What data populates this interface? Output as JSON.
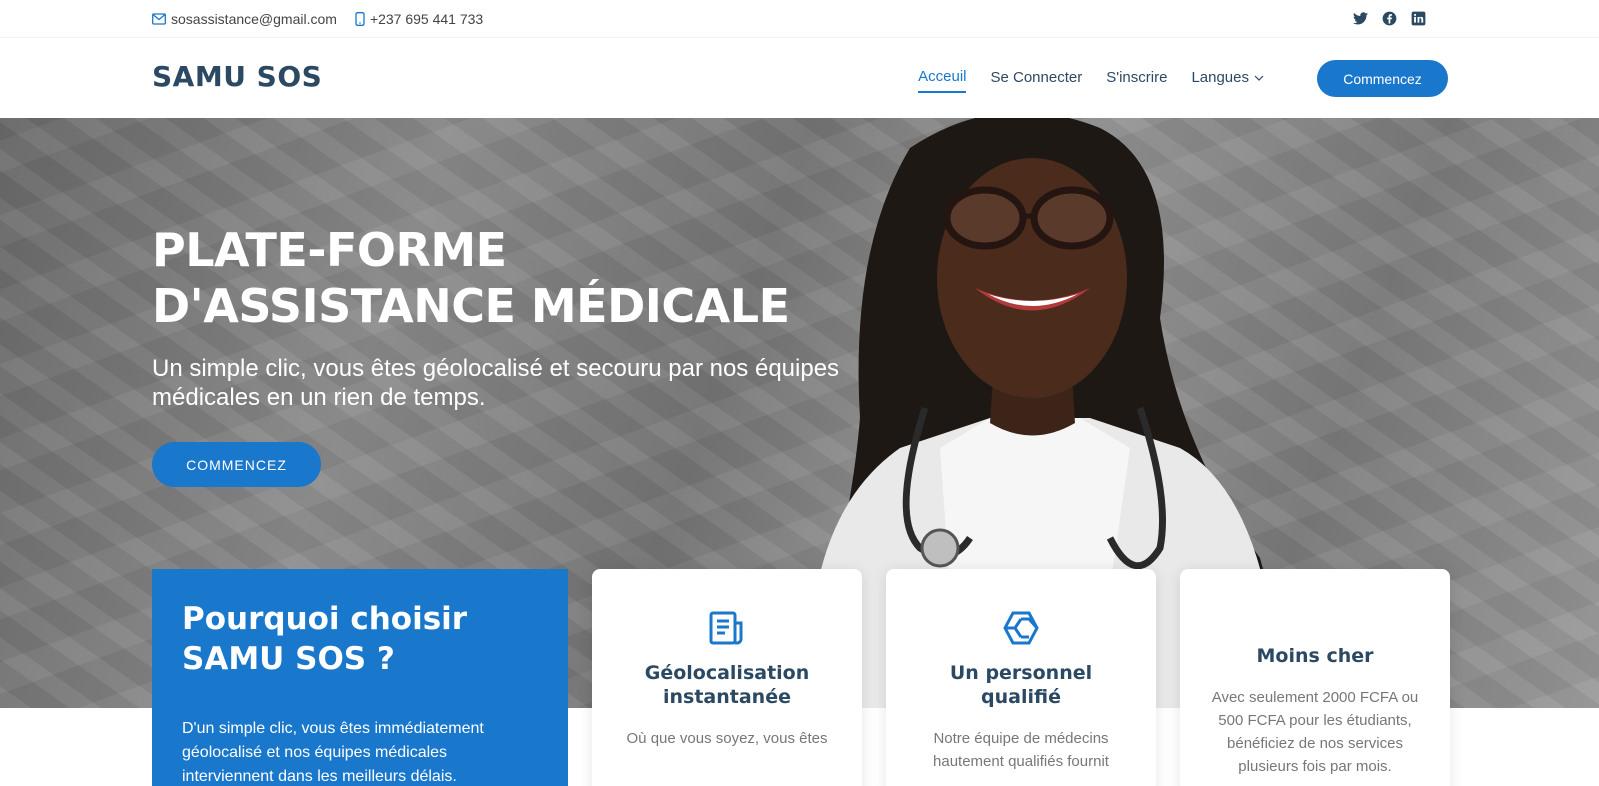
{
  "topbar": {
    "email": "sosassistance@gmail.com",
    "phone": "+237 695 441 733",
    "social": [
      "twitter-icon",
      "facebook-icon",
      "linkedin-icon"
    ]
  },
  "header": {
    "logo": "SAMU SOS",
    "nav": [
      {
        "label": "Acceuil",
        "active": true
      },
      {
        "label": "Se Connecter"
      },
      {
        "label": "S'inscrire"
      },
      {
        "label": "Langues"
      }
    ],
    "cta": "Commencez"
  },
  "hero": {
    "title": "PLATE-FORME D'ASSISTANCE MÉDICALE",
    "subtitle": "Un simple clic, vous êtes géolocalisé et secouru par nos équipes médicales en un rien de temps.",
    "button": "COMMENCEZ"
  },
  "why": {
    "title": "Pourquoi choisir SAMU SOS ?",
    "text": "D'un simple clic, vous êtes immédiatement géolocalisé et nos équipes médicales interviennent dans les meilleurs délais."
  },
  "features": [
    {
      "icon": "document-icon",
      "title": "Géolocalisation instantanée",
      "text": "Où que vous soyez, vous êtes"
    },
    {
      "icon": "cube-icon",
      "title": "Un personnel qualifié",
      "text": "Notre équipe de médecins hautement qualifiés fournit"
    },
    {
      "icon": "",
      "title": "Moins cher",
      "text": "Avec seulement 2000 FCFA ou 500 FCFA pour les étudiants, bénéficiez de nos services plusieurs fois par mois."
    }
  ],
  "colors": {
    "primary": "#1977cc",
    "heading": "#2c4964"
  }
}
